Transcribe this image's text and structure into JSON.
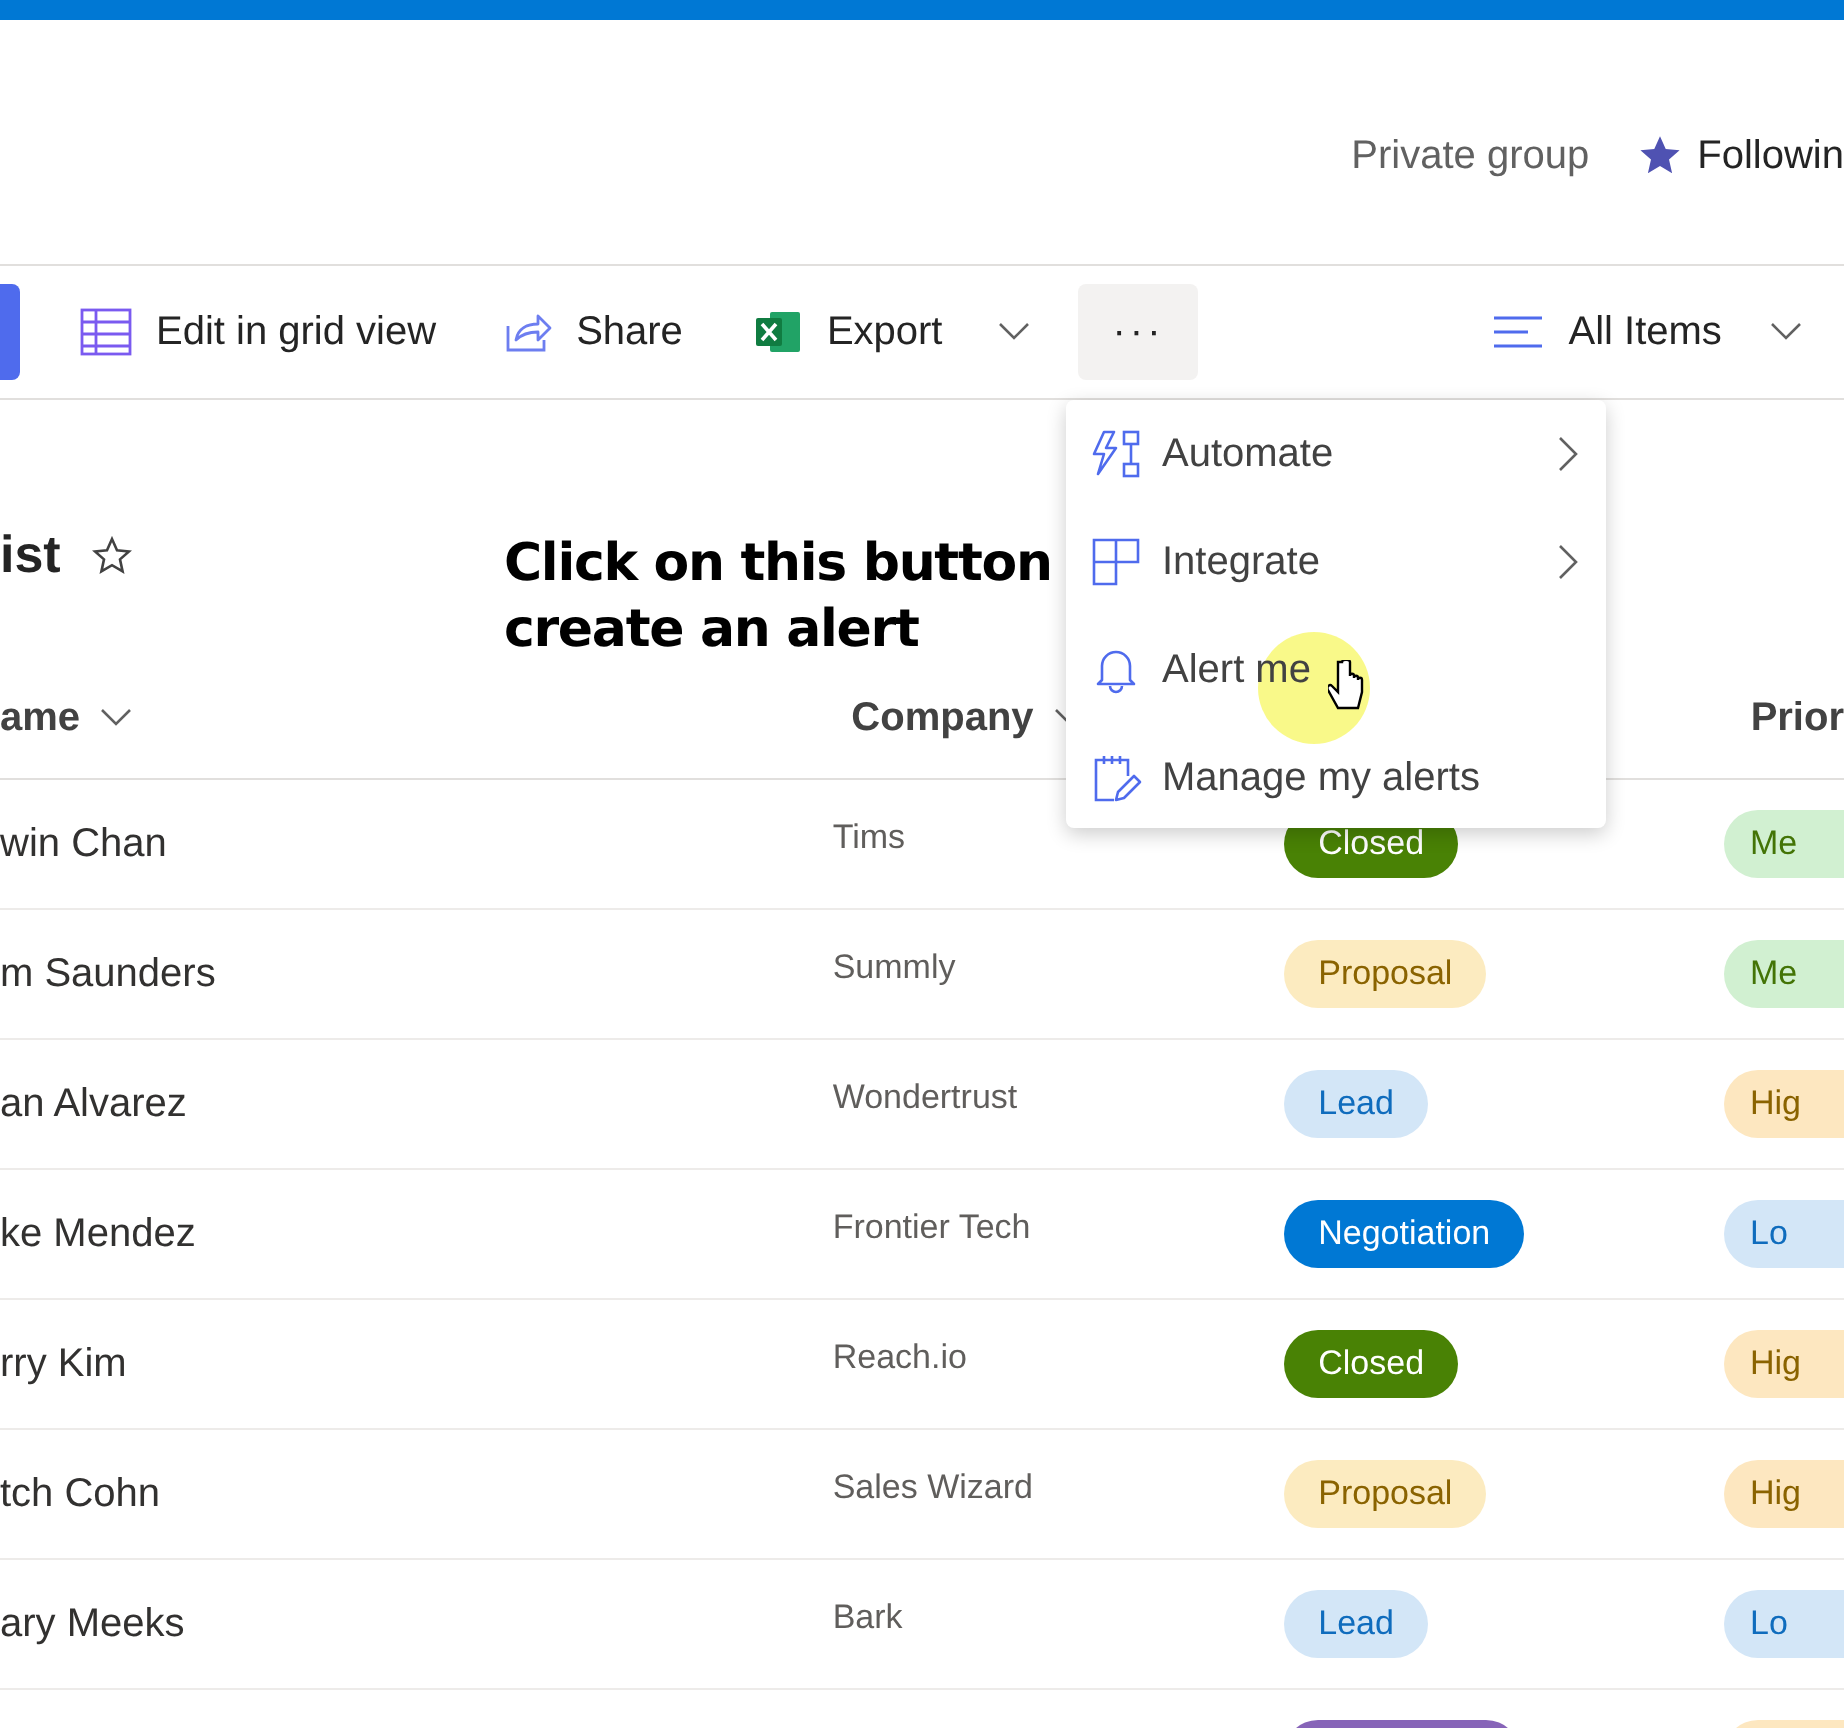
{
  "header": {
    "group_type": "Private group",
    "follow": "Followin"
  },
  "toolbar": [
    {
      "kind": "grid",
      "label": "Edit in grid view"
    },
    {
      "kind": "share",
      "label": "Share"
    },
    {
      "kind": "export",
      "label": "Export"
    }
  ],
  "more_button": {
    "label": "···",
    "selected": true
  },
  "view_switcher": {
    "label": "All Items"
  },
  "menu": [
    {
      "kind": "automate",
      "label": "Automate",
      "submenu": true
    },
    {
      "kind": "integrate",
      "label": "Integrate",
      "submenu": true
    },
    {
      "kind": "alert",
      "label": "Alert me",
      "submenu": false
    },
    {
      "kind": "manage",
      "label": "Manage my alerts",
      "submenu": false
    }
  ],
  "list_title": "ist",
  "annotation": "Click on this button create an alert",
  "columns": [
    "ame",
    "Company",
    "Prior"
  ],
  "rows": [
    {
      "name": "win Chan",
      "company": "Tims",
      "status": {
        "label": "Closed",
        "kind": "closed"
      },
      "priority": {
        "label": "Me",
        "kind": "medium"
      }
    },
    {
      "name": "m Saunders",
      "company": "Summly",
      "status": {
        "label": "Proposal",
        "kind": "proposal"
      },
      "priority": {
        "label": "Me",
        "kind": "medium"
      }
    },
    {
      "name": "an Alvarez",
      "company": "Wondertrust",
      "status": {
        "label": "Lead",
        "kind": "lead"
      },
      "priority": {
        "label": "Hig",
        "kind": "high"
      }
    },
    {
      "name": "ke Mendez",
      "company": "Frontier Tech",
      "status": {
        "label": "Negotiation",
        "kind": "negotiation"
      },
      "priority": {
        "label": "Lo",
        "kind": "low"
      }
    },
    {
      "name": "rry Kim",
      "company": "Reach.io",
      "status": {
        "label": "Closed",
        "kind": "closed"
      },
      "priority": {
        "label": "Hig",
        "kind": "high"
      }
    },
    {
      "name": "tch Cohn",
      "company": "Sales Wizard",
      "status": {
        "label": "Proposal",
        "kind": "proposal"
      },
      "priority": {
        "label": "Hig",
        "kind": "high"
      }
    },
    {
      "name": "ary Meeks",
      "company": "Bark",
      "status": {
        "label": "Lead",
        "kind": "lead"
      },
      "priority": {
        "label": "Lo",
        "kind": "low"
      }
    },
    {
      "status": {
        "kind": "other"
      },
      "priority": {
        "kind": "high"
      }
    }
  ]
}
